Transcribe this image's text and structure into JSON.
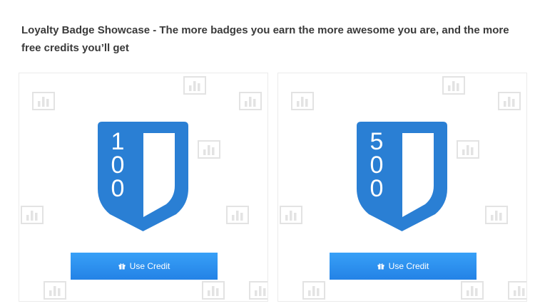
{
  "intro": "Loyalty Badge Showcase - The more badges you earn the more awesome you are, and the more free credits you’ll get",
  "cards": [
    {
      "badge_digits": [
        "1",
        "0",
        "0"
      ],
      "button_label": "Use Credit",
      "button_icon": "gift-icon"
    },
    {
      "badge_digits": [
        "5",
        "0",
        "0"
      ],
      "button_label": "Use Credit",
      "button_icon": "gift-icon"
    }
  ],
  "colors": {
    "badge": "#2a7fd4",
    "button": "#2d8ff0",
    "background_icon": "#e3e3e3"
  },
  "background_icon": "bar-chart-icon"
}
